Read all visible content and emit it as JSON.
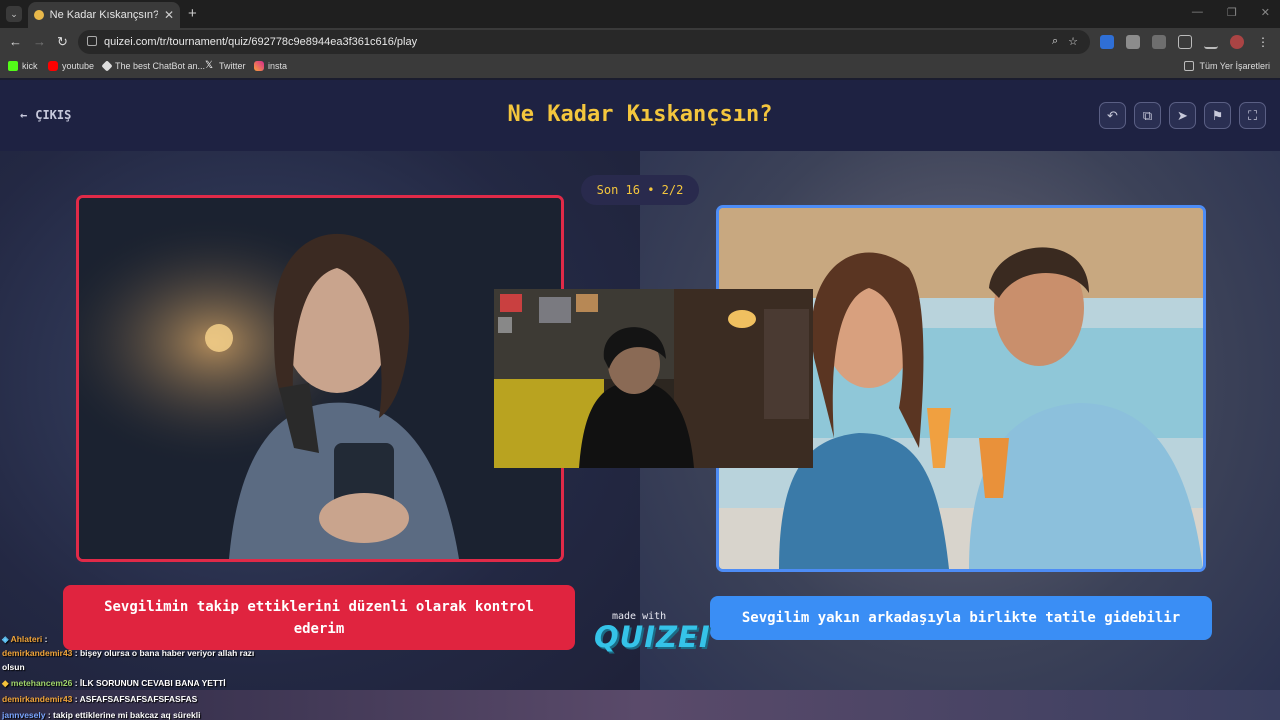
{
  "browser": {
    "tab_title": "Ne Kadar Kıskançsın? - Tier List",
    "url": "quizei.com/tr/tournament/quiz/692778c9e8944ea3f361c616/play",
    "bookmarks": [
      "kick",
      "youtube",
      "The best ChatBot an...",
      "Twitter",
      "insta"
    ],
    "bookmarks_folder": "Tüm Yer İşaretleri"
  },
  "header": {
    "exit_label": "ÇIKIŞ",
    "title": "Ne Kadar Kıskançsın?"
  },
  "round": "Son 16 • 2/2",
  "options": {
    "left": "Sevgilimin takip ettiklerini düzenli olarak kontrol ederim",
    "right": "Sevgilim yakın arkadaşıyla birlikte tatile gidebilir"
  },
  "branding": {
    "made_with": "made with",
    "logo": "QUIZEI"
  },
  "chat": [
    {
      "user": "Ahlateri",
      "message": ""
    },
    {
      "user": "demirkandemir43",
      "message": "bişey olursa o bana haber veriyor allah razı olsun"
    },
    {
      "user": "metehancem26",
      "message": "İLK SORUNUN CEVABI BANA YETTİ"
    },
    {
      "user": "demirkandemir43",
      "message": "ASFAFSAFSAFSAFSFASFAS"
    },
    {
      "user": "jannvesely",
      "message": "takip ettiklerine mi bakcaz aq sürekli"
    }
  ],
  "colors": {
    "title": "#f4c63d",
    "left_accent": "#e0243f",
    "right_accent": "#3a8ef5"
  }
}
